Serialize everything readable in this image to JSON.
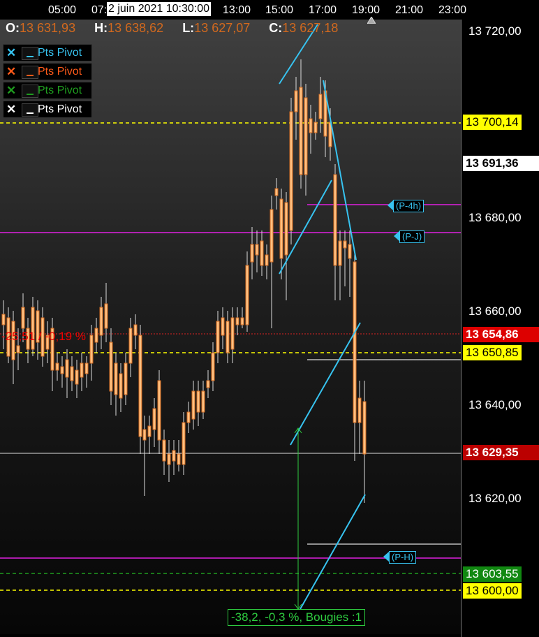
{
  "time_axis": {
    "labels": [
      "05:00",
      "07:",
      "13:00",
      "15:00",
      "17:00",
      "19:00",
      "21:00",
      "23:00"
    ],
    "date_box": "2 juin 2021 10:30:00"
  },
  "ohlc": {
    "open_key": "O:",
    "open": "13 631,93",
    "high_key": "H:",
    "high": "13 638,62",
    "low_key": "L:",
    "low": "13 627,07",
    "close_key": "C:",
    "close": "13 627,18"
  },
  "legend": [
    {
      "label": "Pts Pivot",
      "color": "#37c3f0"
    },
    {
      "label": "Pts Pivot",
      "color": "#ff5a1a"
    },
    {
      "label": "Pts Pivot",
      "color": "#1f9e1f"
    },
    {
      "label": "Pts Pivot",
      "color": "#ffffff"
    }
  ],
  "price_axis": {
    "labels": [
      "13 720,00",
      "13 680,00",
      "13 660,00",
      "13 640,00",
      "13 620,00"
    ],
    "tags": [
      {
        "text": "13 700,14",
        "bg": "#ffff00",
        "fg": "#000000",
        "bold": false
      },
      {
        "text": "13 691,36",
        "bg": "#ffffff",
        "fg": "#000000",
        "bold": true
      },
      {
        "text": "13 654,86",
        "bg": "#dd0000",
        "fg": "#ffffff",
        "bold": true
      },
      {
        "text": "13 650,85",
        "bg": "#ffff00",
        "fg": "#000000",
        "bold": false
      },
      {
        "text": "13 629,35",
        "bg": "#bb0000",
        "fg": "#ffffff",
        "bold": true
      },
      {
        "text": "13 603,55",
        "bg": "#118811",
        "fg": "#ffffff",
        "bold": false
      },
      {
        "text": "13 600,00",
        "bg": "#ffff00",
        "fg": "#000000",
        "bold": false
      }
    ]
  },
  "pivots": [
    "(P-4h)",
    "(P-J)",
    "(P-H)"
  ],
  "change_label": "-25,51 / -0,19 %",
  "measure_label": "-38,2, -0,3 %, Bougies :1",
  "colors": {
    "bull_candle": "#c8f0ff",
    "bull_border": "#37c3f0",
    "bear_candle": "#ffc080",
    "bear_border": "#d2691e",
    "magenta": "#e020e0",
    "yellow_dash": "#ffff00",
    "trend_line": "#37c3f0"
  }
}
